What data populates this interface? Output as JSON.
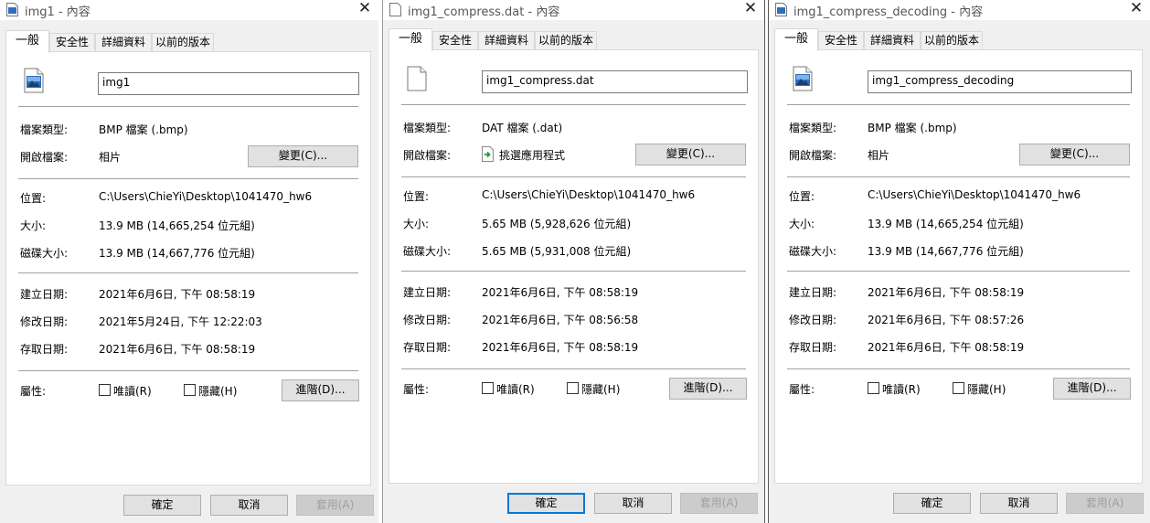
{
  "labels": {
    "tab_general": "一般",
    "tab_security": "安全性",
    "tab_details": "詳細資料",
    "tab_previous": "以前的版本",
    "file_type": "檔案類型:",
    "opens_with": "開啟檔案:",
    "location": "位置:",
    "size": "大小:",
    "size_on_disk": "磁碟大小:",
    "created": "建立日期:",
    "modified": "修改日期:",
    "accessed": "存取日期:",
    "attributes": "屬性:",
    "readonly": "唯讀(R)",
    "hidden": "隱藏(H)",
    "change_button": "變更(C)...",
    "advanced_button": "進階(D)...",
    "ok_button": "確定",
    "cancel_button": "取消",
    "apply_button": "套用(A)"
  },
  "windows": [
    {
      "title": "img1 - 內容",
      "file_name": "img1",
      "file_icon": "bitmap-file-icon",
      "file_type": "BMP 檔案 (.bmp)",
      "opens_with": "相片",
      "opens_with_icon": "",
      "location": "C:\\Users\\ChieYi\\Desktop\\1041470_hw6",
      "size": "13.9 MB (14,665,254 位元組)",
      "size_on_disk": "13.9 MB (14,667,776 位元組)",
      "created": "2021年6月6日, 下午 08:58:19",
      "modified": "2021年5月24日, 下午 12:22:03",
      "accessed": "2021年6月6日, 下午 08:58:19"
    },
    {
      "title": "img1_compress.dat - 內容",
      "file_name": "img1_compress.dat",
      "file_icon": "blank-file-icon",
      "file_type": "DAT 檔案 (.dat)",
      "opens_with": "挑選應用程式",
      "opens_with_icon": "pick-app-icon",
      "location": "C:\\Users\\ChieYi\\Desktop\\1041470_hw6",
      "size": "5.65 MB (5,928,626 位元組)",
      "size_on_disk": "5.65 MB (5,931,008 位元組)",
      "created": "2021年6月6日, 下午 08:58:19",
      "modified": "2021年6月6日, 下午 08:56:58",
      "accessed": "2021年6月6日, 下午 08:58:19"
    },
    {
      "title": "img1_compress_decoding - 內容",
      "file_name": "img1_compress_decoding",
      "file_icon": "bitmap-file-icon",
      "file_type": "BMP 檔案 (.bmp)",
      "opens_with": "相片",
      "opens_with_icon": "",
      "location": "C:\\Users\\ChieYi\\Desktop\\1041470_hw6",
      "size": "13.9 MB (14,665,254 位元組)",
      "size_on_disk": "13.9 MB (14,667,776 位元組)",
      "created": "2021年6月6日, 下午 08:58:19",
      "modified": "2021年6月6日, 下午 08:57:26",
      "accessed": "2021年6月6日, 下午 08:58:19"
    }
  ],
  "colors": {
    "window_bg": "#f0f0f0",
    "panel_bg": "#ffffff",
    "focus_border": "#0078d7",
    "disabled_text": "#a0a0a0"
  }
}
